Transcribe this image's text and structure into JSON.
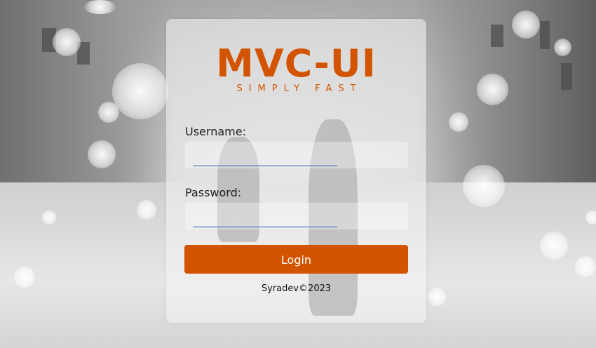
{
  "logo": {
    "title": "MVC-UI",
    "tagline": "SIMPLY FAST"
  },
  "form": {
    "username_label": "Username:",
    "username_value": "",
    "password_label": "Password:",
    "password_value": "",
    "login_label": "Login"
  },
  "footer": {
    "copyright": "Syradev©2023"
  },
  "colors": {
    "accent": "#d35400",
    "input_underline": "#1f5fa8"
  }
}
